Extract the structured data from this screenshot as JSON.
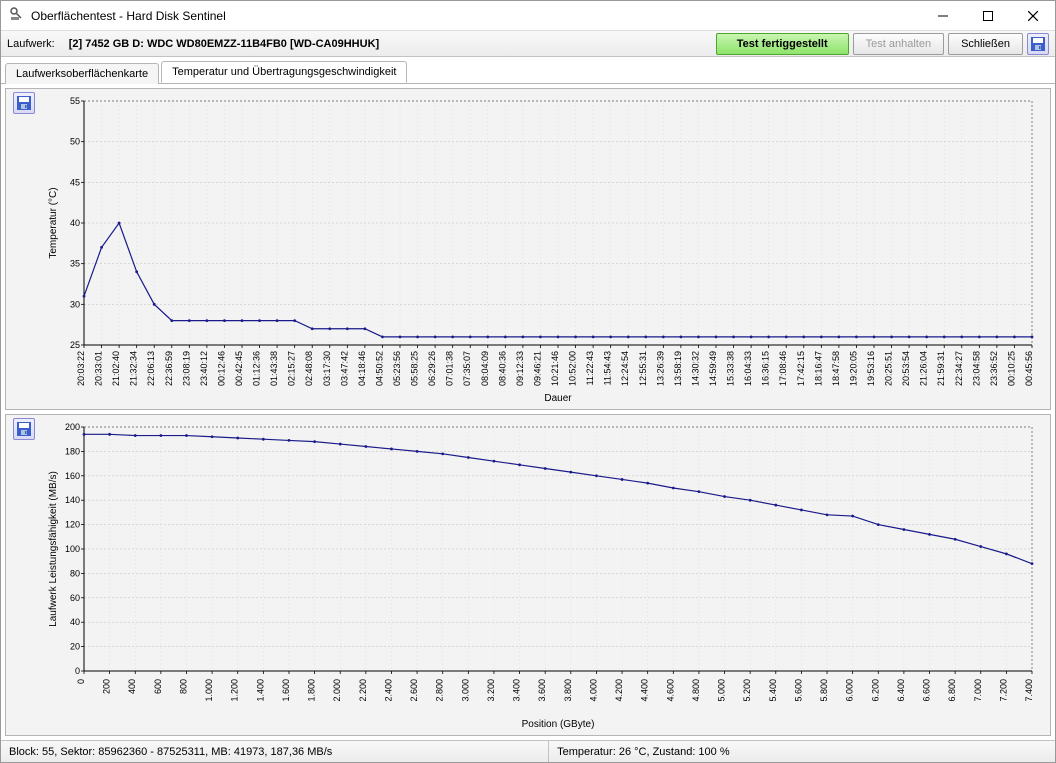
{
  "window": {
    "title": "Oberflächentest - Hard Disk Sentinel"
  },
  "toolbar": {
    "drive_label": "Laufwerk:",
    "drive_value": "[2] 7452 GB D: WDC WD80EMZZ-11B4FB0 [WD-CA09HHUK]",
    "test_done": "Test fertiggestellt",
    "stop_test": "Test anhalten",
    "close": "Schließen"
  },
  "tabs": {
    "surface": "Laufwerksoberflächenkarte",
    "temp_speed": "Temperatur und Übertragungsgeschwindigkeit"
  },
  "status": {
    "left": "Block: 55, Sektor: 85962360 - 87525311, MB: 41973, 187,36 MB/s",
    "right": "Temperatur: 26  °C,  Zustand: 100 %"
  },
  "chart_data": [
    {
      "type": "line",
      "title": "",
      "xlabel": "Dauer",
      "ylabel": "Temperatur (°C)",
      "ylim": [
        25,
        55
      ],
      "categories": [
        "20:03:22",
        "20:33:01",
        "21:02:40",
        "21:32:34",
        "22:06:13",
        "22:36:59",
        "23:08:19",
        "23:40:12",
        "00:12:46",
        "00:42:45",
        "01:12:36",
        "01:43:38",
        "02:15:27",
        "02:48:08",
        "03:17:30",
        "03:47:42",
        "04:18:46",
        "04:50:52",
        "05:23:56",
        "05:58:25",
        "06:29:26",
        "07:01:38",
        "07:35:07",
        "08:04:09",
        "08:40:36",
        "09:12:33",
        "09:46:21",
        "10:21:46",
        "10:52:00",
        "11:22:43",
        "11:54:43",
        "12:24:54",
        "12:55:31",
        "13:26:39",
        "13:58:19",
        "14:30:32",
        "14:59:49",
        "15:33:38",
        "16:04:33",
        "16:36:15",
        "17:08:46",
        "17:42:15",
        "18:16:47",
        "18:47:58",
        "19:20:05",
        "19:53:16",
        "20:25:51",
        "20:53:54",
        "21:26:04",
        "21:59:31",
        "22:34:27",
        "23:04:58",
        "23:36:52",
        "00:10:25",
        "00:45:56"
      ],
      "values": [
        31,
        37,
        40,
        34,
        30,
        28,
        28,
        28,
        28,
        28,
        28,
        28,
        28,
        27,
        27,
        27,
        27,
        26,
        26,
        26,
        26,
        26,
        26,
        26,
        26,
        26,
        26,
        26,
        26,
        26,
        26,
        26,
        26,
        26,
        26,
        26,
        26,
        26,
        26,
        26,
        26,
        26,
        26,
        26,
        26,
        26,
        26,
        26,
        26,
        26,
        26,
        26,
        26,
        26,
        26
      ]
    },
    {
      "type": "line",
      "title": "",
      "xlabel": "Position (GByte)",
      "ylabel": "Laufwerk Leistungsfähigkeit (MB/s)",
      "ylim": [
        0,
        200
      ],
      "x": [
        0,
        200,
        400,
        600,
        800,
        1000,
        1200,
        1400,
        1600,
        1800,
        2000,
        2200,
        2400,
        2600,
        2800,
        3000,
        3200,
        3400,
        3600,
        3800,
        4000,
        4200,
        4400,
        4600,
        4800,
        5000,
        5200,
        5400,
        5600,
        5800,
        6000,
        6200,
        6400,
        6600,
        6800,
        7000,
        7200,
        7400
      ],
      "values": [
        194,
        194,
        193,
        193,
        193,
        192,
        191,
        190,
        189,
        188,
        186,
        184,
        182,
        180,
        178,
        175,
        172,
        169,
        166,
        163,
        160,
        157,
        154,
        150,
        147,
        143,
        140,
        136,
        132,
        128,
        127,
        120,
        116,
        112,
        108,
        102,
        96,
        88
      ]
    }
  ]
}
